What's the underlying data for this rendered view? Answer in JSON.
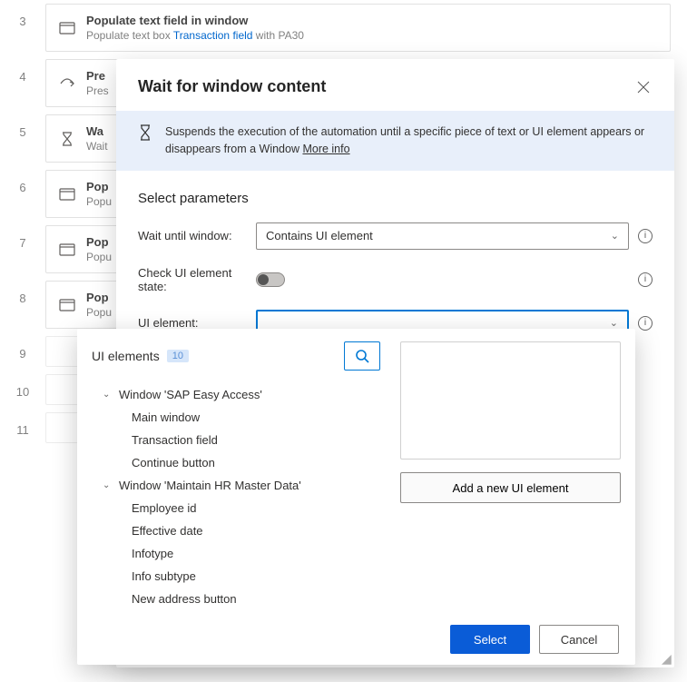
{
  "steps": [
    {
      "num": "3",
      "icon": "window",
      "title": "Populate text field in window",
      "sub_prefix": "Populate text box ",
      "sub_link": "Transaction field",
      "sub_suffix": " with ",
      "sub_value": "PA30"
    },
    {
      "num": "4",
      "icon": "cursor",
      "title": "Pre",
      "sub_prefix": "Pres"
    },
    {
      "num": "5",
      "icon": "hourglass",
      "title": "Wa",
      "sub_prefix": "Wait"
    },
    {
      "num": "6",
      "icon": "window",
      "title": "Pop",
      "sub_prefix": "Popu"
    },
    {
      "num": "7",
      "icon": "window",
      "title": "Pop",
      "sub_prefix": "Popu"
    },
    {
      "num": "8",
      "icon": "window",
      "title": "Pop",
      "sub_prefix": "Popu"
    },
    {
      "num": "9",
      "icon": "",
      "title": "",
      "sub_prefix": ""
    },
    {
      "num": "10",
      "icon": "",
      "title": "",
      "sub_prefix": ""
    },
    {
      "num": "11",
      "icon": "",
      "title": "",
      "sub_prefix": ""
    }
  ],
  "dialog": {
    "title": "Wait for window content",
    "info": "Suspends the execution of the automation until a specific piece of text or UI element appears or disappears from a Window ",
    "more_info": "More info",
    "params_title": "Select parameters",
    "wait_label": "Wait until window:",
    "wait_value": "Contains UI element",
    "check_label": "Check UI element state:",
    "element_label": "UI element:",
    "element_value": ""
  },
  "picker": {
    "title": "UI elements",
    "badge": "10",
    "groups": [
      {
        "label": "Window 'SAP Easy Access'",
        "items": [
          "Main window",
          "Transaction field",
          "Continue button"
        ]
      },
      {
        "label": "Window 'Maintain HR Master Data'",
        "items": [
          "Employee id",
          "Effective date",
          "Infotype",
          "Info subtype",
          "New address button"
        ]
      }
    ],
    "add_button": "Add a new UI element",
    "select": "Select",
    "cancel": "Cancel"
  }
}
